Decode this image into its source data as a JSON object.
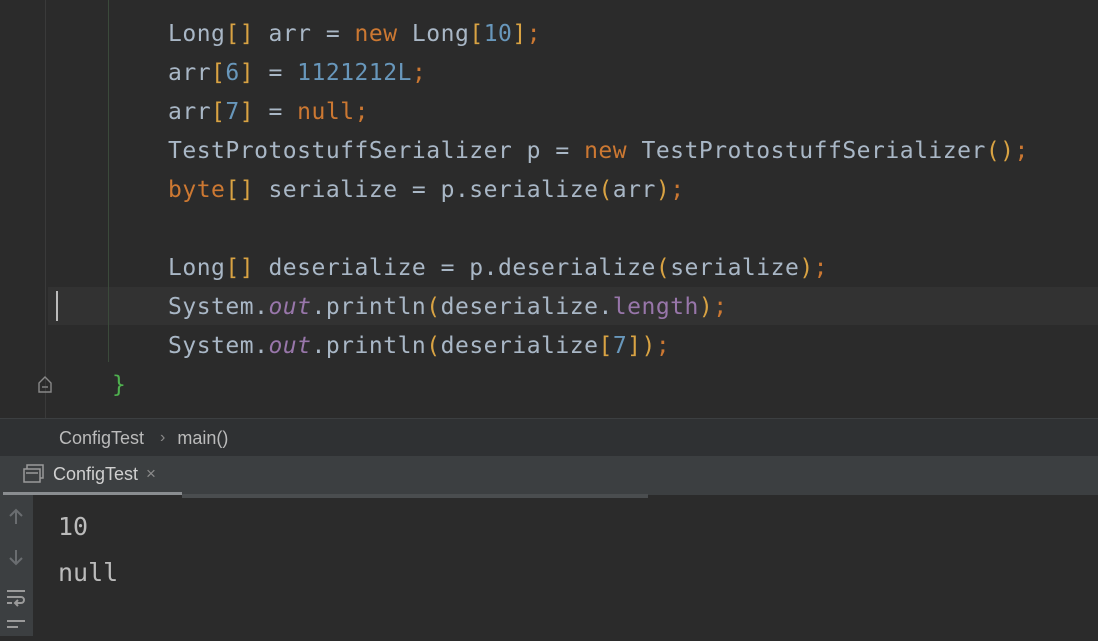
{
  "editor": {
    "lines": [
      [
        {
          "t": "Long",
          "c": "t-type"
        },
        {
          "t": "[]",
          "c": "t-brk"
        },
        {
          "t": " arr = ",
          "c": "t-type"
        },
        {
          "t": "new",
          "c": "t-kw"
        },
        {
          "t": " Long",
          "c": "t-type"
        },
        {
          "t": "[",
          "c": "t-brk"
        },
        {
          "t": "10",
          "c": "t-num"
        },
        {
          "t": "]",
          "c": "t-brk"
        },
        {
          "t": ";",
          "c": "t-semi"
        }
      ],
      [
        {
          "t": "arr",
          "c": "t-type"
        },
        {
          "t": "[",
          "c": "t-brk"
        },
        {
          "t": "6",
          "c": "t-num"
        },
        {
          "t": "]",
          "c": "t-brk"
        },
        {
          "t": " = ",
          "c": "t-type"
        },
        {
          "t": "1121212L",
          "c": "t-num"
        },
        {
          "t": ";",
          "c": "t-semi"
        }
      ],
      [
        {
          "t": "arr",
          "c": "t-type"
        },
        {
          "t": "[",
          "c": "t-brk"
        },
        {
          "t": "7",
          "c": "t-num"
        },
        {
          "t": "]",
          "c": "t-brk"
        },
        {
          "t": " = ",
          "c": "t-type"
        },
        {
          "t": "null",
          "c": "t-kw"
        },
        {
          "t": ";",
          "c": "t-semi"
        }
      ],
      [
        {
          "t": "TestProtostuffSerializer p = ",
          "c": "t-type"
        },
        {
          "t": "new",
          "c": "t-kw"
        },
        {
          "t": " TestProtostuffSerializer",
          "c": "t-type"
        },
        {
          "t": "()",
          "c": "t-brk"
        },
        {
          "t": ";",
          "c": "t-semi"
        }
      ],
      [
        {
          "t": "byte",
          "c": "t-kw"
        },
        {
          "t": "[]",
          "c": "t-brk"
        },
        {
          "t": " serialize = p.serialize",
          "c": "t-type"
        },
        {
          "t": "(",
          "c": "t-brk"
        },
        {
          "t": "arr",
          "c": "t-type"
        },
        {
          "t": ")",
          "c": "t-brk"
        },
        {
          "t": ";",
          "c": "t-semi"
        }
      ],
      [],
      [
        {
          "t": "Long",
          "c": "t-type"
        },
        {
          "t": "[]",
          "c": "t-brk"
        },
        {
          "t": " deserialize = p.deserialize",
          "c": "t-type"
        },
        {
          "t": "(",
          "c": "t-brk"
        },
        {
          "t": "serialize",
          "c": "t-type"
        },
        {
          "t": ")",
          "c": "t-brk"
        },
        {
          "t": ";",
          "c": "t-semi"
        }
      ],
      [
        {
          "t": "System.",
          "c": "t-type"
        },
        {
          "t": "out",
          "c": "t-field"
        },
        {
          "t": ".println",
          "c": "t-type"
        },
        {
          "t": "(",
          "c": "t-brk"
        },
        {
          "t": "deserialize.",
          "c": "t-type"
        },
        {
          "t": "length",
          "c": "t-prop"
        },
        {
          "t": ")",
          "c": "t-brk"
        },
        {
          "t": ";",
          "c": "t-semi"
        }
      ],
      [
        {
          "t": "System.",
          "c": "t-type"
        },
        {
          "t": "out",
          "c": "t-field"
        },
        {
          "t": ".println",
          "c": "t-type"
        },
        {
          "t": "(",
          "c": "t-brk"
        },
        {
          "t": "deserialize",
          "c": "t-type"
        },
        {
          "t": "[",
          "c": "t-brk"
        },
        {
          "t": "7",
          "c": "t-num"
        },
        {
          "t": "]",
          "c": "t-brk"
        },
        {
          "t": ")",
          "c": "t-brk"
        },
        {
          "t": ";",
          "c": "t-semi"
        }
      ],
      [
        {
          "t": "}",
          "c": "t-green"
        }
      ]
    ],
    "current_line_index": 7
  },
  "breadcrumb": {
    "class_name": "ConfigTest",
    "method_name": "main()"
  },
  "run_window": {
    "tab_label": "ConfigTest",
    "tab_close": "×",
    "output": [
      "10",
      "null"
    ]
  },
  "colors": {
    "background": "#2b2b2b",
    "keyword": "#cc7832",
    "number": "#6897bb",
    "field": "#9876aa",
    "text": "#a9b7c6"
  }
}
